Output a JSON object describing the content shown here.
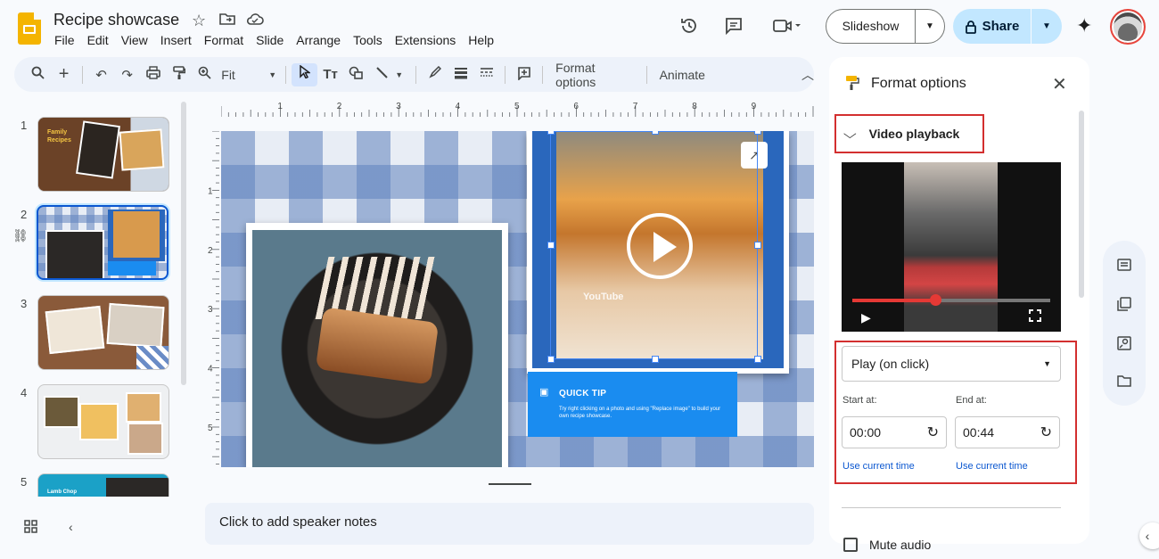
{
  "header": {
    "title": "Recipe showcase",
    "menu": [
      "File",
      "Edit",
      "View",
      "Insert",
      "Format",
      "Slide",
      "Arrange",
      "Tools",
      "Extensions",
      "Help"
    ],
    "slideshow_label": "Slideshow",
    "share_label": "Share",
    "icons": [
      "star-icon",
      "move-to-folder-icon",
      "cloud-status-icon",
      "history-icon",
      "comments-icon",
      "meet-icon",
      "gemini-icon",
      "avatar"
    ]
  },
  "toolbar": {
    "zoom_value": "Fit",
    "format_options_label": "Format options",
    "animate_label": "Animate"
  },
  "filmstrip": {
    "slides": [
      {
        "number": "1",
        "title_text": "Family Recipes"
      },
      {
        "number": "2"
      },
      {
        "number": "3"
      },
      {
        "number": "4"
      },
      {
        "number": "5",
        "title_text": "Lamb Chop"
      }
    ]
  },
  "ruler": {
    "h_ticks": [
      "1",
      "2",
      "3",
      "4",
      "5",
      "6",
      "7",
      "8",
      "9"
    ],
    "v_ticks": [
      "1",
      "2",
      "3",
      "4",
      "5"
    ]
  },
  "slide": {
    "youtube_label": "YouTube",
    "tip_title": "QUICK TIP",
    "tip_body": "Try right clicking on a photo and using \"Replace image\" to build your own recipe showcase."
  },
  "notes": {
    "placeholder": "Click to add speaker notes"
  },
  "format_panel": {
    "title": "Format options",
    "section_title": "Video playback",
    "play_mode": "Play (on click)",
    "start_label": "Start at:",
    "end_label": "End at:",
    "start_value": "00:00",
    "end_value": "00:44",
    "use_current_time": "Use current time",
    "mute_label": "Mute audio",
    "video_progress": 0.42
  },
  "colors": {
    "accent": "#0b57d0",
    "share_bg": "#c2e7ff",
    "highlight_box": "#d32f2f",
    "app_logo": "#f4b400"
  }
}
